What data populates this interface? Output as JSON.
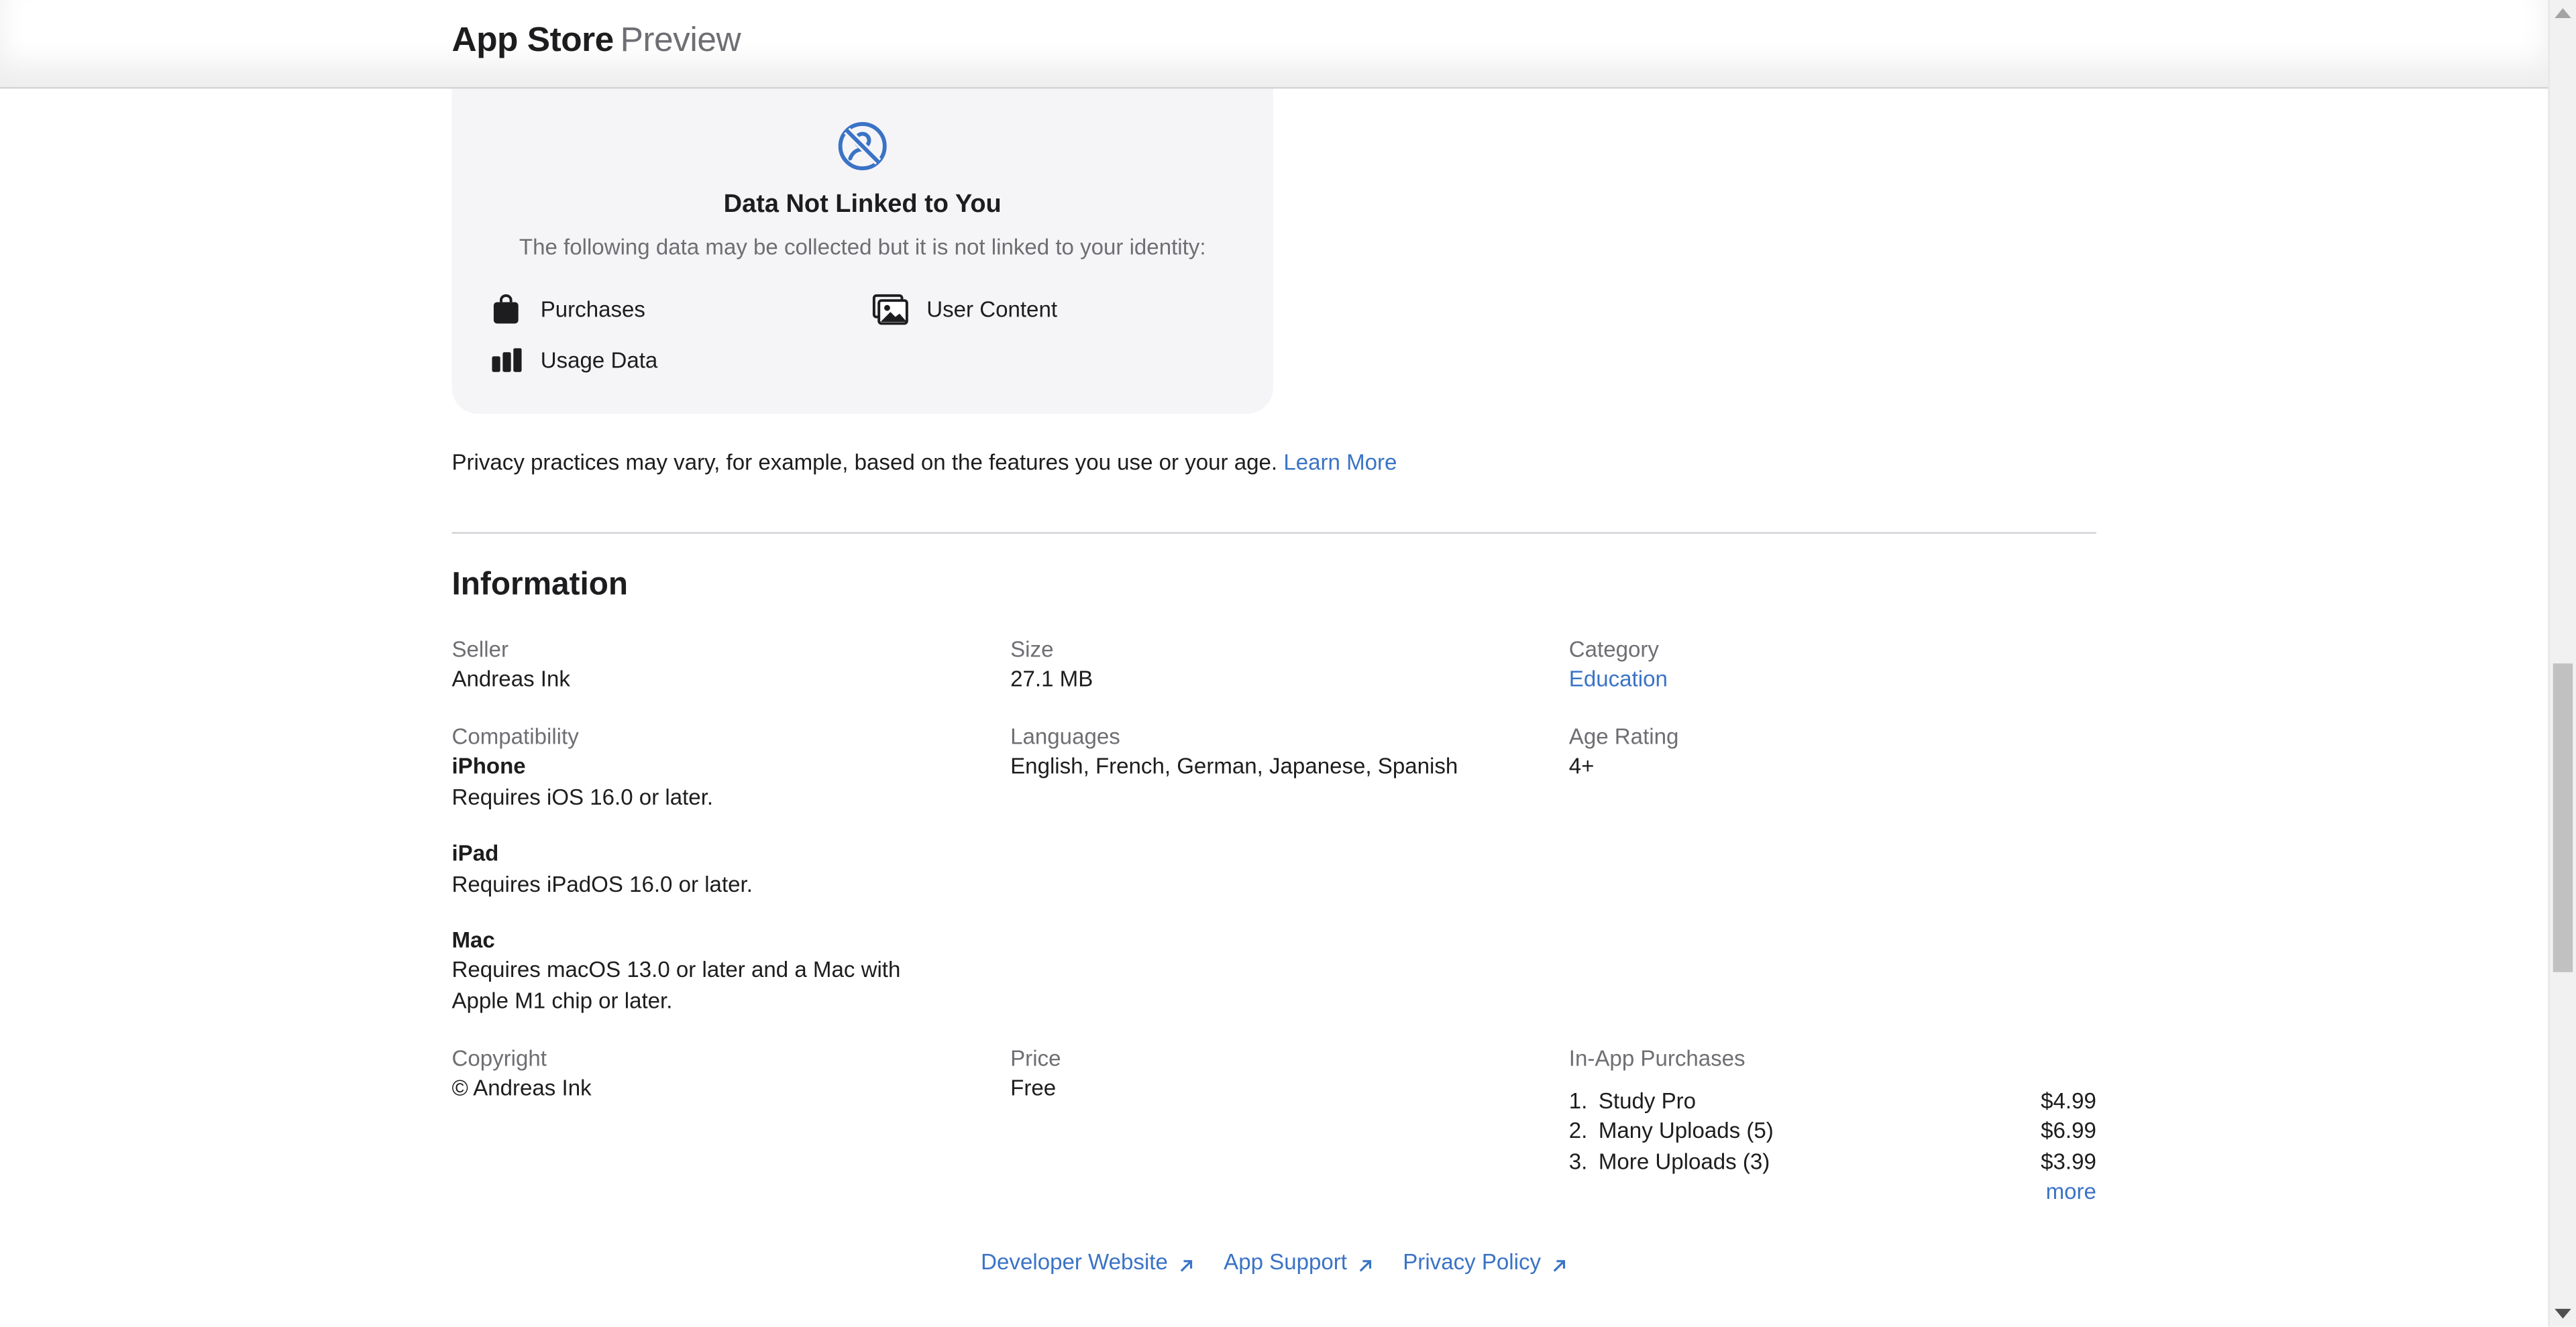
{
  "header": {
    "brand_main": "App Store",
    "brand_sub": "Preview"
  },
  "privacy_card": {
    "icon": "not-linked-icon",
    "title": "Data Not Linked to You",
    "description": "The following data may be collected but it is not linked to your identity:",
    "items": [
      {
        "label": "Purchases",
        "icon": "shopping-bag-icon"
      },
      {
        "label": "User Content",
        "icon": "photos-icon"
      },
      {
        "label": "Usage Data",
        "icon": "bar-chart-icon"
      }
    ]
  },
  "privacy_note": {
    "text": "Privacy practices may vary, for example, based on the features you use or your age.",
    "link": "Learn More"
  },
  "information": {
    "title": "Information",
    "seller": {
      "label": "Seller",
      "value": "Andreas Ink"
    },
    "size": {
      "label": "Size",
      "value": "27.1 MB"
    },
    "category": {
      "label": "Category",
      "value": "Education"
    },
    "compatibility": {
      "label": "Compatibility",
      "devices": [
        {
          "name": "iPhone",
          "req": "Requires iOS 16.0 or later."
        },
        {
          "name": "iPad",
          "req": "Requires iPadOS 16.0 or later."
        },
        {
          "name": "Mac",
          "req_line1": "Requires macOS 13.0 or later and a Mac with",
          "req_line2": "Apple M1 chip or later."
        }
      ]
    },
    "languages": {
      "label": "Languages",
      "value": "English, French, German, Japanese, Spanish"
    },
    "age_rating": {
      "label": "Age Rating",
      "value": "4+"
    },
    "copyright": {
      "label": "Copyright",
      "value": "© Andreas Ink"
    },
    "price": {
      "label": "Price",
      "value": "Free"
    },
    "in_app": {
      "label": "In-App Purchases",
      "items": [
        {
          "num": "1.",
          "name": "Study Pro",
          "price": "$4.99"
        },
        {
          "num": "2.",
          "name": "Many Uploads (5)",
          "price": "$6.99"
        },
        {
          "num": "3.",
          "name": "More Uploads (3)",
          "price": "$3.99"
        }
      ],
      "more": "more"
    }
  },
  "footer": {
    "links": [
      "Developer Website",
      "App Support",
      "Privacy Policy"
    ]
  },
  "colors": {
    "link": "#3a73c6",
    "card_bg": "#f5f5f7",
    "secondary_text": "#6e6e73"
  }
}
